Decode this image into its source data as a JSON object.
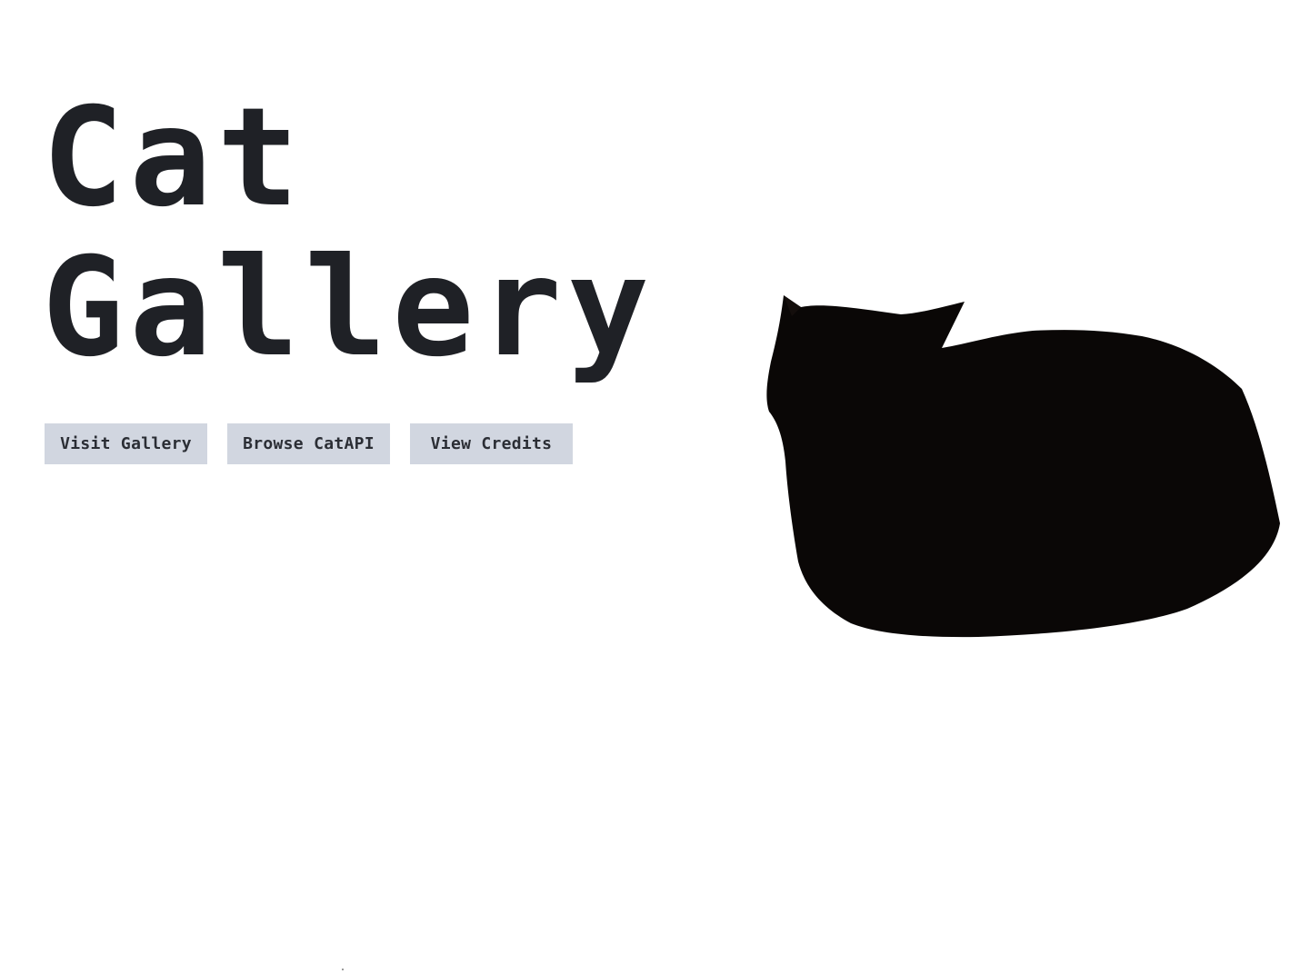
{
  "hero": {
    "title_line_1": "Cat",
    "title_line_2": "Gallery"
  },
  "buttons": [
    {
      "label": "Visit Gallery"
    },
    {
      "label": "Browse CatAPI"
    },
    {
      "label": "View Credits"
    }
  ],
  "colors": {
    "background": "#ffffff",
    "title": "#1f2126",
    "button_bg": "#d1d6e0",
    "button_text": "#2b2e35",
    "cat": "#0a0706"
  },
  "image": {
    "subject": "black cat loaf"
  }
}
